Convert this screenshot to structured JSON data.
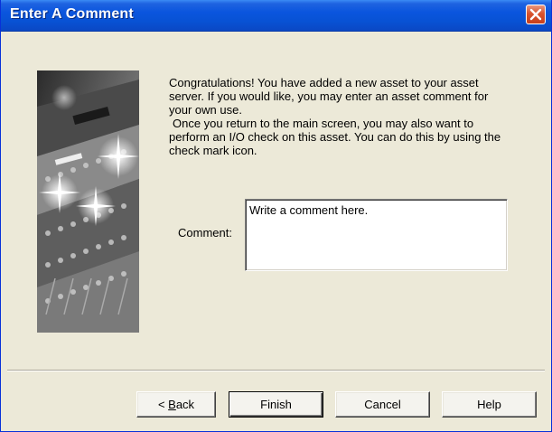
{
  "window": {
    "title": "Enter A Comment"
  },
  "message": {
    "paragraph1": "Congratulations!  You have added a new asset to your asset server.  If you would like, you may enter an asset comment for your own use.",
    "paragraph2": "Once you return to the main screen, you may also want to perform an I/O check on this asset.  You can do this by using the check mark icon."
  },
  "comment": {
    "label": "Comment:",
    "value": "Write a comment here."
  },
  "buttons": {
    "back_prefix": "< ",
    "back_mnemonic": "B",
    "back_rest": "ack",
    "finish": "Finish",
    "cancel": "Cancel",
    "help": "Help"
  },
  "colors": {
    "titlebar": "#0a55de",
    "dialog_bg": "#ece9d8",
    "close_button": "#d8532e"
  },
  "icons": {
    "close": "close-icon",
    "side_image": "mixing-console-image"
  }
}
